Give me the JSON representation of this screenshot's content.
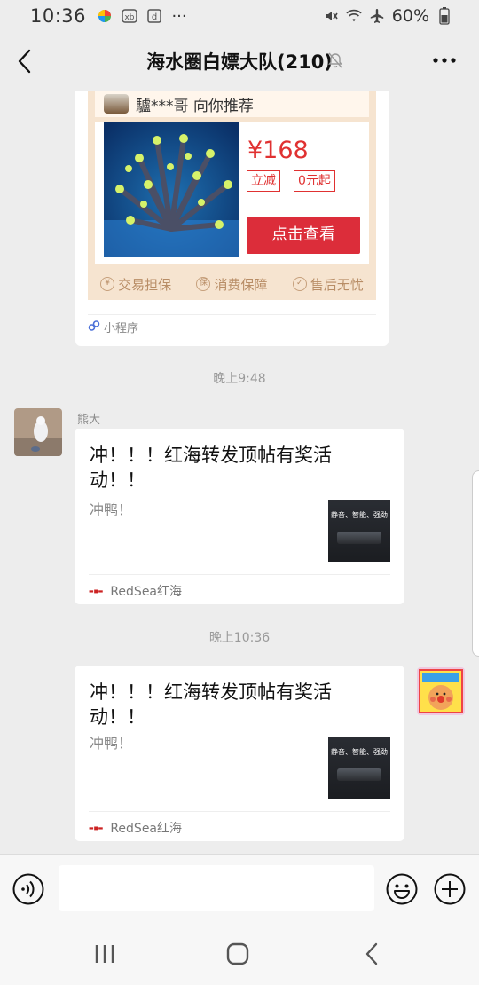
{
  "status_bar": {
    "time": "10:36",
    "battery": "60%",
    "icons": [
      "color-app-icon",
      "badge-app-icon",
      "d-app-icon",
      "more-dots-icon",
      "mute-icon",
      "wifi-icon",
      "airplane-icon",
      "battery-icon"
    ]
  },
  "header": {
    "title": "海水圈白嫖大队(210)",
    "icons": [
      "back-icon",
      "mute-bell-icon",
      "more-icon"
    ]
  },
  "mini_program_card": {
    "recommender": "驢***哥 向你推荐",
    "price": "¥168",
    "tags": [
      "立减",
      "0元起"
    ],
    "cta": "点击查看",
    "guarantees": [
      "交易担保",
      "消费保障",
      "售后无忧"
    ],
    "footer": "小程序"
  },
  "messages": [
    {
      "timestamp": "晚上9:48",
      "sender": "熊大",
      "title": "冲！！！红海转发顶帖有奖活动！！",
      "description": "冲鸭！",
      "thumb_text": "静音、智能、强劲",
      "source": "RedSea红海"
    },
    {
      "timestamp": "晚上10:36",
      "title": "冲！！！红海转发顶帖有奖活动！！",
      "description": "冲鸭！",
      "thumb_text": "静音、智能、强劲",
      "source": "RedSea红海"
    }
  ],
  "input_bar": {
    "placeholder": "",
    "icons": [
      "voice-icon",
      "emoji-icon",
      "plus-icon"
    ]
  },
  "system_nav": [
    "recent-apps-icon",
    "home-icon",
    "back-icon"
  ]
}
